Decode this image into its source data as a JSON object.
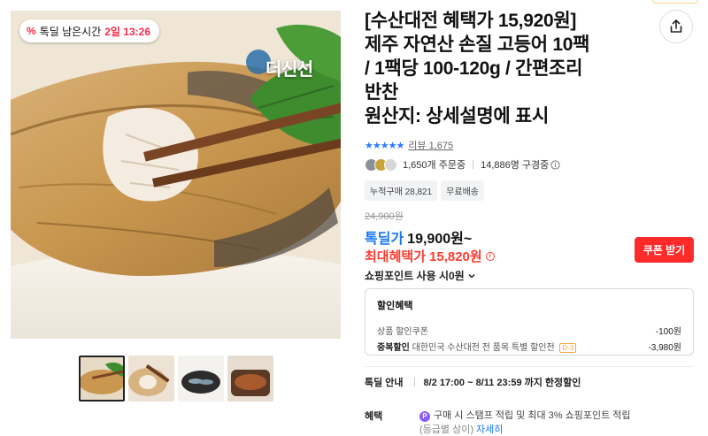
{
  "colors": {
    "accent_red": "#ff2b2b",
    "deal_blue": "#1877f2",
    "star_blue": "#2f7bff",
    "timer_red": "#ff2b4e"
  },
  "hero": {
    "deal_pill": {
      "icon": "percent-icon",
      "label": "톡딜 남은시간",
      "timer": "2일 13:26"
    },
    "brand_watermark": "더신선"
  },
  "thumbnails": [
    {
      "name": "thumb-1",
      "active": true
    },
    {
      "name": "thumb-2",
      "active": false
    },
    {
      "name": "thumb-3",
      "active": false
    },
    {
      "name": "thumb-4",
      "active": false
    }
  ],
  "product": {
    "title_lines": [
      "[수산대전 혜택가 15,920원]",
      "제주 자연산 손질 고등어 10팩",
      "/ 1팩당 100-120g / 간편조리",
      "반찬",
      "원산지: 상세설명에 표시"
    ],
    "share_icon": "share-icon"
  },
  "rating": {
    "stars": 4.5,
    "stars_text": "★★★★★",
    "review_label": "리뷰 1,675"
  },
  "stats": {
    "orders": "1,650개 주문중",
    "subscribers": "14,886명 구경중",
    "info_icon": "info-icon"
  },
  "chips": [
    "누적구매 28,821",
    "무료배송"
  ],
  "price": {
    "original": "24,900원",
    "deal_label": "톡딜가",
    "deal_value": "19,900원~",
    "max_label": "최대혜택가",
    "max_value": "15,820원",
    "coupon_button": "쿠폰 받기",
    "point_use": "쇼핑포인트 사용 시0원"
  },
  "discount": {
    "heading": "할인혜택",
    "rows": [
      {
        "label": "상품 할인쿠폰",
        "detail": "",
        "badge": "",
        "amount": "-100원"
      },
      {
        "label": "중복할인",
        "detail": "대한민국 수산대전 전 품목 특별 할인전",
        "badge": "D-3",
        "amount": "-3,980원"
      }
    ]
  },
  "deal_info": {
    "label": "톡딜 안내",
    "schedule": "8/2 17:00 ~ 8/11 23:59 까지 한정할인"
  },
  "benefit": {
    "label": "혜택",
    "text": "구매 시 스탬프 적립 및 최대 3% 쇼핑포인트 적립",
    "text2": "(등급별 상이)",
    "more": "자세히"
  }
}
